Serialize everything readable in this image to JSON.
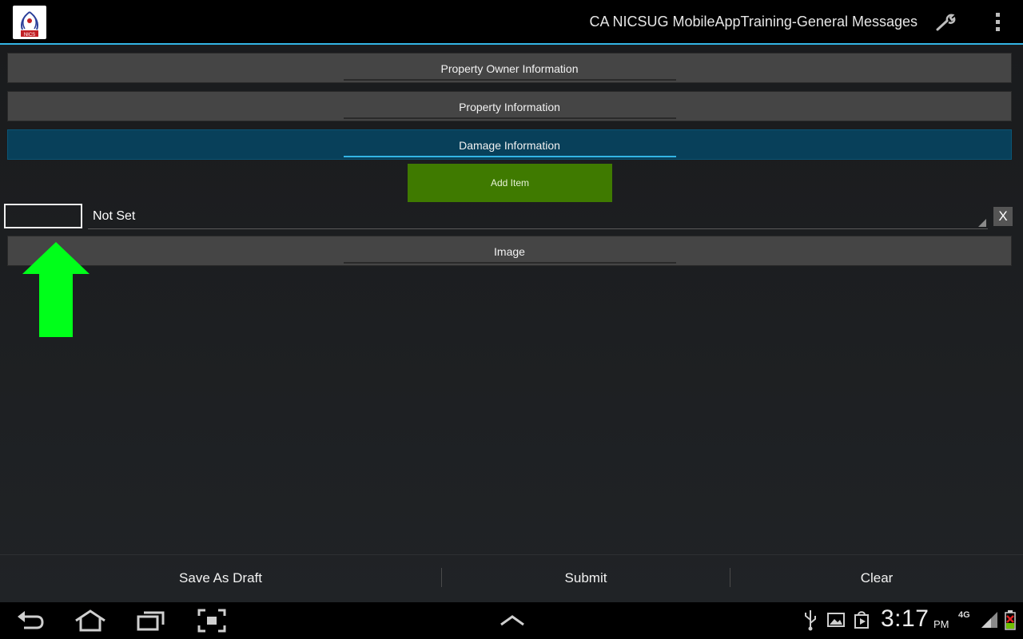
{
  "action_bar": {
    "title": "CA NICSUG MobileAppTraining-General Messages",
    "logo_text": "NICS"
  },
  "sections": {
    "owner": "Property Owner Information",
    "property": "Property Information",
    "damage": "Damage Information",
    "image": "Image"
  },
  "damage": {
    "add_item_label": "Add Item",
    "item_input_value": "",
    "spinner_value": "Not Set",
    "delete_label": "X"
  },
  "bottom_actions": {
    "save_draft": "Save As Draft",
    "submit": "Submit",
    "clear": "Clear"
  },
  "status_bar": {
    "time": "3:17",
    "ampm": "PM",
    "network": "4G"
  },
  "colors": {
    "accent": "#33b5e5",
    "active_section": "#08405a",
    "add_button": "#3f7a00",
    "arrow": "#00ff1a"
  }
}
